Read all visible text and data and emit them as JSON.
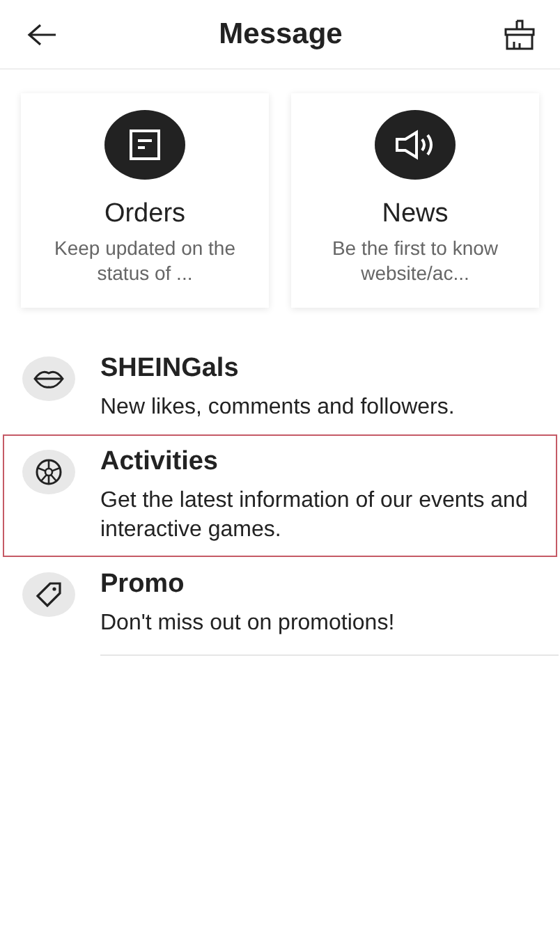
{
  "header": {
    "title": "Message"
  },
  "cards": [
    {
      "kind": "orders",
      "title": "Orders",
      "description": "Keep updated on the status of ..."
    },
    {
      "kind": "news",
      "title": "News",
      "description": "Be the first to know website/ac..."
    }
  ],
  "items": [
    {
      "kind": "lips",
      "title": "SHEINGals",
      "description": "New likes, comments and followers.",
      "selected": false
    },
    {
      "kind": "wheel",
      "title": "Activities",
      "description": "Get the latest information of our events and interactive games.",
      "selected": true
    },
    {
      "kind": "tag",
      "title": "Promo",
      "description": "Don't miss out on promotions!",
      "selected": false
    }
  ]
}
